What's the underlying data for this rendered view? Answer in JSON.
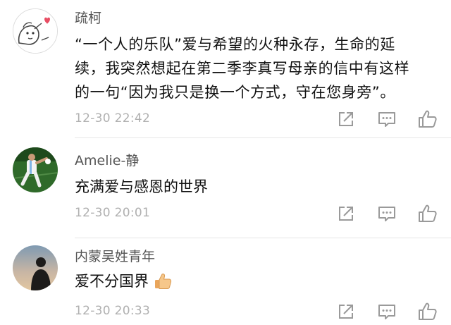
{
  "comments": [
    {
      "username": "疏柯",
      "lines": [
        "“一个人的乐队”爱与希望的火种永存，生命的延",
        "续，我突然想起在第二季李真写母亲的信中有这样",
        "的一句“因为我只是换一个方式，守在您身旁”。"
      ],
      "time": "12-30 22:42"
    },
    {
      "username": "Amelie-静",
      "text": "充满爱与感恩的世界",
      "time": "12-30 20:01"
    },
    {
      "username": "内蒙吴姓青年",
      "text": "爱不分国界",
      "time": "12-30 20:33"
    }
  ],
  "icons": {
    "share": "share-icon",
    "reply": "reply-icon",
    "like": "thumbs-up-icon",
    "emoji": "thumbs-up-emoji"
  },
  "colors": {
    "username": "#555555",
    "timestamp": "#b0b0b0",
    "icon": "#9a9a9a",
    "divider": "#e6e6e6"
  }
}
